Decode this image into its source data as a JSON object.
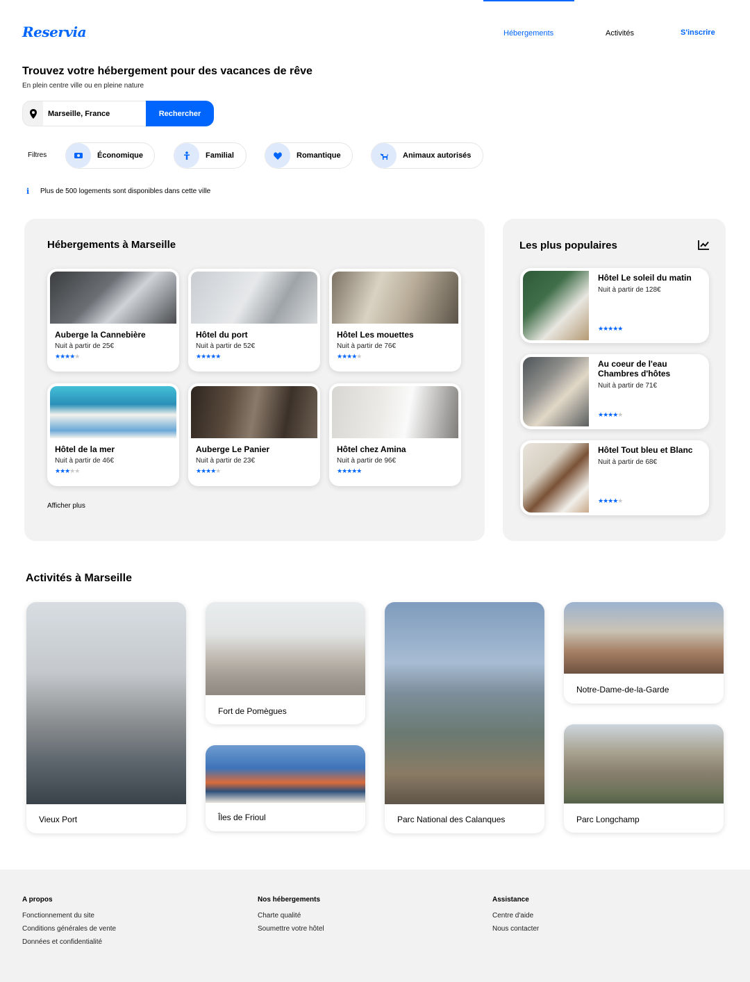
{
  "header": {
    "logo": "Reservia",
    "nav": [
      {
        "label": "Hébergements",
        "active": true
      },
      {
        "label": "Activités",
        "active": false
      }
    ],
    "signup": "S'inscrire"
  },
  "hero": {
    "title": "Trouvez votre hébergement pour des vacances de rêve",
    "subtitle": "En plein centre ville ou en pleine nature",
    "search_value": "Marseille, France",
    "search_button": "Rechercher"
  },
  "filters": {
    "label": "Filtres",
    "items": [
      "Économique",
      "Familial",
      "Romantique",
      "Animaux autorisés"
    ]
  },
  "info": "Plus de 500 logements sont disponibles dans cette ville",
  "accommodations": {
    "title": "Hébergements à Marseille",
    "cards": [
      {
        "name": "Auberge la Cannebière",
        "price": "Nuit à partir de 25€",
        "rating": 4
      },
      {
        "name": "Hôtel du port",
        "price": "Nuit à partir de 52€",
        "rating": 5
      },
      {
        "name": "Hôtel Les mouettes",
        "price": "Nuit à partir de 76€",
        "rating": 4
      },
      {
        "name": "Hôtel de la mer",
        "price": "Nuit à partir de 46€",
        "rating": 3
      },
      {
        "name": "Auberge Le Panier",
        "price": "Nuit à partir de 23€",
        "rating": 4
      },
      {
        "name": "Hôtel chez Amina",
        "price": "Nuit à partir de 96€",
        "rating": 5
      }
    ],
    "show_more": "Afficher plus"
  },
  "popular": {
    "title": "Les plus populaires",
    "cards": [
      {
        "name": "Hôtel Le soleil du matin",
        "price": "Nuit à partir de 128€",
        "rating": 5
      },
      {
        "name": "Au coeur de l'eau Chambres d'hôtes",
        "price": "Nuit à partir de 71€",
        "rating": 4
      },
      {
        "name": "Hôtel Tout bleu et Blanc",
        "price": "Nuit à partir de 68€",
        "rating": 4
      }
    ]
  },
  "activities": {
    "title": "Activités à Marseille",
    "items": [
      "Vieux Port",
      "Fort de Pomègues",
      "Îles de Frioul",
      "Parc National des Calanques",
      "Notre-Dame-de-la-Garde",
      "Parc Longchamp"
    ]
  },
  "footer": {
    "columns": [
      {
        "title": "A propos",
        "links": [
          "Fonctionnement du site",
          "Conditions générales de vente",
          "Données et confidentialité"
        ]
      },
      {
        "title": "Nos hébergements",
        "links": [
          "Charte qualité",
          "Soumettre votre hôtel"
        ]
      },
      {
        "title": "Assistance",
        "links": [
          "Centre d'aide",
          "Nous contacter"
        ]
      }
    ]
  },
  "colors": {
    "primary": "#0065fc",
    "panel": "#f2f2f2",
    "icon_bg": "#dee9fc"
  }
}
